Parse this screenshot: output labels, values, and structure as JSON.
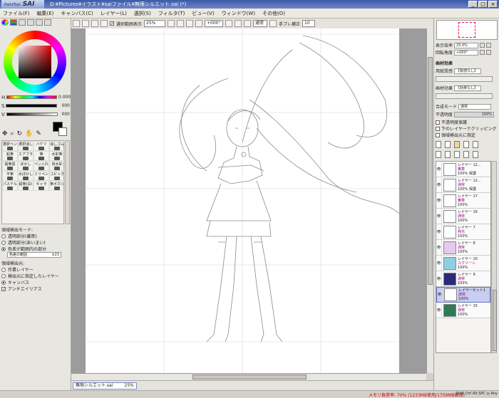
{
  "app": {
    "logo": "SAI",
    "logo_small": "PaintTool",
    "title": "D:¥Pictures¥イラスト¥saiファイル¥無限シルエット.sai (*)"
  },
  "window_buttons": [
    "_",
    "□",
    "×"
  ],
  "menu": [
    "ファイル(F)",
    "編集(E)",
    "キャンバス(C)",
    "レイヤー(L)",
    "選択(S)",
    "フィルタ(T)",
    "ビュー(V)",
    "ウィンドウ(W)",
    "その他(O)"
  ],
  "toolbar": {
    "selection_label": "選択範囲表示",
    "zoom": "25%",
    "angle": "+000°",
    "blend": "通常",
    "stabilizer_label": "手ブレ補正",
    "stabilizer_value": "10"
  },
  "color": {
    "current": "#000000",
    "secondary": "#ffffff",
    "sliders": [
      {
        "key": "H",
        "value": "0.000"
      },
      {
        "key": "S",
        "value": "000"
      },
      {
        "key": "V",
        "value": "000"
      }
    ]
  },
  "brushes": [
    "選択ペン",
    "選択消し",
    "バケツ",
    "消しゴム",
    "鉛筆",
    "エアブラシ",
    "筆",
    "水彩筆",
    "鉛筆黒",
    "ぼかし",
    "ペン入れ",
    "旧水彩",
    "平筆",
    "水ぼかし",
    "ミリペン",
    "コピック",
    "パステル",
    "鉛筆(白)",
    "ギャラ",
    "筆ボカシ"
  ],
  "fill_options": {
    "mode_label": "領域検出モード:",
    "modes": [
      "透明部分(厳密)",
      "透明部分(あいまい)",
      "色差が範囲内の部分"
    ],
    "selected_mode": 2,
    "range_label": "色差の範囲",
    "range_value": "±23",
    "source_label": "領域検出元:",
    "sources": [
      "作業レイヤー",
      "検出元に指定したレイヤー",
      "キャンバス"
    ],
    "selected_source": 2,
    "antialias_label": "アンチエイリアス"
  },
  "document": {
    "tab_name": "無限シルエット.sai",
    "tab_zoom": "25%"
  },
  "status": {
    "memory": "メモリ負荷率: 70% (1233MB使用/1759MB確保)",
    "keys": "Shift Ctrl Alt SPC ◎ Any"
  },
  "navigator": {
    "zoom_label": "表示倍率",
    "zoom_value": "25.0%",
    "rotate_label": "回転角度",
    "rotate_value": "+000°"
  },
  "layer_props": {
    "paper_label": "画材効果",
    "texture_label": "用紙質感",
    "texture_value": "【質感なし】",
    "effect_label": "画材効果",
    "effect_value": "【効果なし】",
    "blend_label": "合成モード",
    "blend_value": "通常",
    "opacity_label": "不透明度",
    "opacity_value": "100%",
    "checks": [
      "不透明度保護",
      "下のレイヤーでクリッピング",
      "領域検出元に指定"
    ]
  },
  "layers": [
    {
      "name": "レイヤー 12...",
      "mode": "乗算",
      "opacity": "100% 保護",
      "thumb": "#ffffff",
      "selected": false
    },
    {
      "name": "レイヤー 12...",
      "mode": "通常",
      "opacity": "100% 保護",
      "thumb": "#ffffff",
      "selected": false
    },
    {
      "name": "レイヤー 17",
      "mode": "乗算",
      "opacity": "100%",
      "thumb": "#ffffff",
      "selected": false
    },
    {
      "name": "レイヤー 16",
      "mode": "通常",
      "opacity": "100%",
      "thumb": "#ffffff",
      "selected": false
    },
    {
      "name": "レイヤー 7",
      "mode": "発光",
      "opacity": "100%",
      "thumb": "#ffffff",
      "selected": false
    },
    {
      "name": "レイヤー 8",
      "mode": "通常",
      "opacity": "100%",
      "thumb": "#e8c8ee",
      "selected": false
    },
    {
      "name": "レイヤー 10",
      "mode": "スクリーン",
      "opacity": "100%",
      "thumb": "#8fcfe0",
      "selected": false
    },
    {
      "name": "レイヤー 9",
      "mode": "通常",
      "opacity": "100%",
      "thumb": "#2a2a7a",
      "selected": false
    },
    {
      "name": "レイヤーセット1",
      "mode": "通常",
      "opacity": "100%",
      "thumb": "#ffffff",
      "selected": true
    },
    {
      "name": "レイヤー 15",
      "mode": "通常",
      "opacity": "100%",
      "thumb": "#2e7a55",
      "selected": false
    }
  ]
}
